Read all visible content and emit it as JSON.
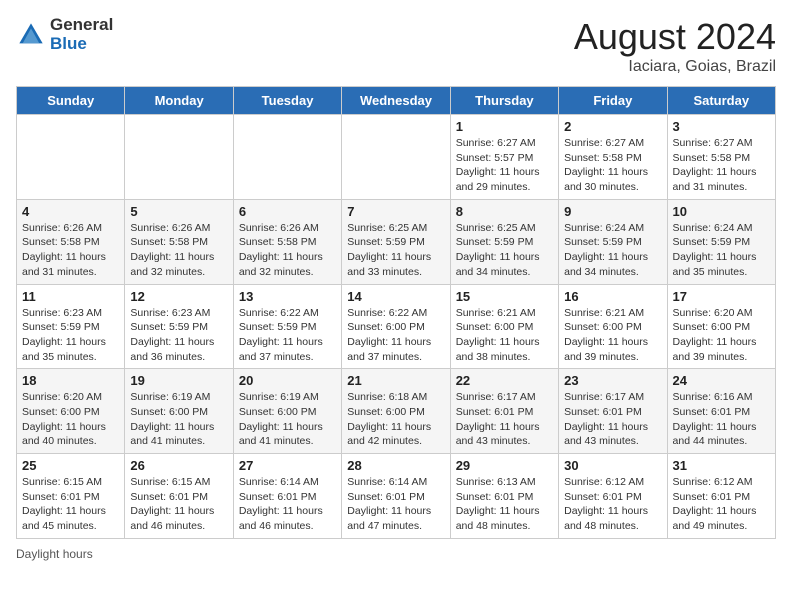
{
  "header": {
    "logo": {
      "general": "General",
      "blue": "Blue"
    },
    "title": "August 2024",
    "location": "Iaciara, Goias, Brazil"
  },
  "days_of_week": [
    "Sunday",
    "Monday",
    "Tuesday",
    "Wednesday",
    "Thursday",
    "Friday",
    "Saturday"
  ],
  "weeks": [
    [
      {
        "day": "",
        "content": ""
      },
      {
        "day": "",
        "content": ""
      },
      {
        "day": "",
        "content": ""
      },
      {
        "day": "",
        "content": ""
      },
      {
        "day": "1",
        "content": "Sunrise: 6:27 AM\nSunset: 5:57 PM\nDaylight: 11 hours and 29 minutes."
      },
      {
        "day": "2",
        "content": "Sunrise: 6:27 AM\nSunset: 5:58 PM\nDaylight: 11 hours and 30 minutes."
      },
      {
        "day": "3",
        "content": "Sunrise: 6:27 AM\nSunset: 5:58 PM\nDaylight: 11 hours and 31 minutes."
      }
    ],
    [
      {
        "day": "4",
        "content": "Sunrise: 6:26 AM\nSunset: 5:58 PM\nDaylight: 11 hours and 31 minutes."
      },
      {
        "day": "5",
        "content": "Sunrise: 6:26 AM\nSunset: 5:58 PM\nDaylight: 11 hours and 32 minutes."
      },
      {
        "day": "6",
        "content": "Sunrise: 6:26 AM\nSunset: 5:58 PM\nDaylight: 11 hours and 32 minutes."
      },
      {
        "day": "7",
        "content": "Sunrise: 6:25 AM\nSunset: 5:59 PM\nDaylight: 11 hours and 33 minutes."
      },
      {
        "day": "8",
        "content": "Sunrise: 6:25 AM\nSunset: 5:59 PM\nDaylight: 11 hours and 34 minutes."
      },
      {
        "day": "9",
        "content": "Sunrise: 6:24 AM\nSunset: 5:59 PM\nDaylight: 11 hours and 34 minutes."
      },
      {
        "day": "10",
        "content": "Sunrise: 6:24 AM\nSunset: 5:59 PM\nDaylight: 11 hours and 35 minutes."
      }
    ],
    [
      {
        "day": "11",
        "content": "Sunrise: 6:23 AM\nSunset: 5:59 PM\nDaylight: 11 hours and 35 minutes."
      },
      {
        "day": "12",
        "content": "Sunrise: 6:23 AM\nSunset: 5:59 PM\nDaylight: 11 hours and 36 minutes."
      },
      {
        "day": "13",
        "content": "Sunrise: 6:22 AM\nSunset: 5:59 PM\nDaylight: 11 hours and 37 minutes."
      },
      {
        "day": "14",
        "content": "Sunrise: 6:22 AM\nSunset: 6:00 PM\nDaylight: 11 hours and 37 minutes."
      },
      {
        "day": "15",
        "content": "Sunrise: 6:21 AM\nSunset: 6:00 PM\nDaylight: 11 hours and 38 minutes."
      },
      {
        "day": "16",
        "content": "Sunrise: 6:21 AM\nSunset: 6:00 PM\nDaylight: 11 hours and 39 minutes."
      },
      {
        "day": "17",
        "content": "Sunrise: 6:20 AM\nSunset: 6:00 PM\nDaylight: 11 hours and 39 minutes."
      }
    ],
    [
      {
        "day": "18",
        "content": "Sunrise: 6:20 AM\nSunset: 6:00 PM\nDaylight: 11 hours and 40 minutes."
      },
      {
        "day": "19",
        "content": "Sunrise: 6:19 AM\nSunset: 6:00 PM\nDaylight: 11 hours and 41 minutes."
      },
      {
        "day": "20",
        "content": "Sunrise: 6:19 AM\nSunset: 6:00 PM\nDaylight: 11 hours and 41 minutes."
      },
      {
        "day": "21",
        "content": "Sunrise: 6:18 AM\nSunset: 6:00 PM\nDaylight: 11 hours and 42 minutes."
      },
      {
        "day": "22",
        "content": "Sunrise: 6:17 AM\nSunset: 6:01 PM\nDaylight: 11 hours and 43 minutes."
      },
      {
        "day": "23",
        "content": "Sunrise: 6:17 AM\nSunset: 6:01 PM\nDaylight: 11 hours and 43 minutes."
      },
      {
        "day": "24",
        "content": "Sunrise: 6:16 AM\nSunset: 6:01 PM\nDaylight: 11 hours and 44 minutes."
      }
    ],
    [
      {
        "day": "25",
        "content": "Sunrise: 6:15 AM\nSunset: 6:01 PM\nDaylight: 11 hours and 45 minutes."
      },
      {
        "day": "26",
        "content": "Sunrise: 6:15 AM\nSunset: 6:01 PM\nDaylight: 11 hours and 46 minutes."
      },
      {
        "day": "27",
        "content": "Sunrise: 6:14 AM\nSunset: 6:01 PM\nDaylight: 11 hours and 46 minutes."
      },
      {
        "day": "28",
        "content": "Sunrise: 6:14 AM\nSunset: 6:01 PM\nDaylight: 11 hours and 47 minutes."
      },
      {
        "day": "29",
        "content": "Sunrise: 6:13 AM\nSunset: 6:01 PM\nDaylight: 11 hours and 48 minutes."
      },
      {
        "day": "30",
        "content": "Sunrise: 6:12 AM\nSunset: 6:01 PM\nDaylight: 11 hours and 48 minutes."
      },
      {
        "day": "31",
        "content": "Sunrise: 6:12 AM\nSunset: 6:01 PM\nDaylight: 11 hours and 49 minutes."
      }
    ]
  ],
  "footer": {
    "daylight_hours_label": "Daylight hours"
  },
  "colors": {
    "header_bg": "#2a6db5",
    "header_text": "#ffffff",
    "even_row_bg": "#f5f5f5",
    "odd_row_bg": "#ffffff"
  }
}
